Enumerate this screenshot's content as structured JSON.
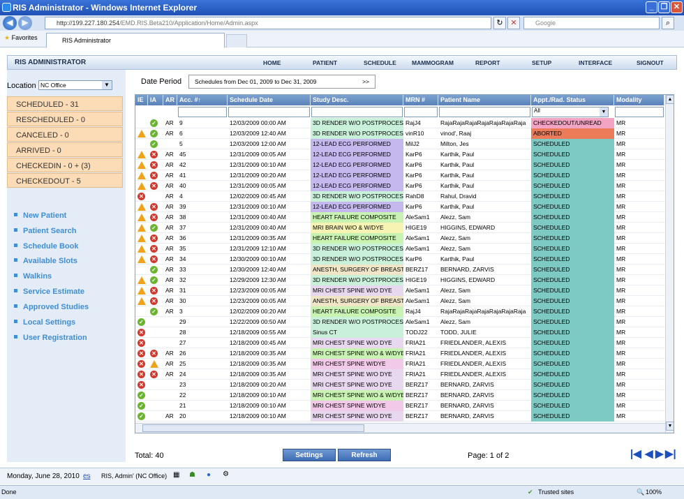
{
  "browser": {
    "title": "RIS Administrator - Windows Internet Explorer",
    "url_host": "http://199.227.180.254",
    "url_path": "/EMD.RIS.Beta210/Application/Home/Admin.aspx",
    "search_placeholder": "Google",
    "favorites_label": "Favorites",
    "tab_label": "RIS Administrator",
    "status_left": "Done",
    "status_zone": "Trusted sites",
    "zoom": "100%"
  },
  "app": {
    "title": "RIS ADMINISTRATOR",
    "menu": [
      "HOME",
      "PATIENT",
      "SCHEDULE",
      "MAMMOGRAM",
      "REPORT",
      "SETUP",
      "INTERFACE",
      "SIGNOUT"
    ]
  },
  "sidebar": {
    "location_label": "Location",
    "location_value": "NC Office",
    "statuses": [
      "SCHEDULED - 31",
      "RESCHEDULED - 0",
      "CANCELED - 0",
      "ARRIVED - 0",
      "CHECKEDIN - 0 + (3)",
      "CHECKEDOUT - 5"
    ],
    "links": [
      "New Patient",
      "Patient Search",
      "Schedule Book",
      "Available Slots",
      "Walkins",
      "Service Estimate",
      "Approved Studies",
      "Local Settings",
      "User Registration"
    ]
  },
  "filter": {
    "date_period_label": "Date Period",
    "date_period_value": "Schedules from Dec 01, 2009 to Dec 31, 2009",
    "arrow": ">>",
    "status_filter": "All"
  },
  "grid": {
    "columns": [
      "IE",
      "IA",
      "AR",
      "Acc. #↑",
      "Schedule Date",
      "Study Desc.",
      "MRN #",
      "Patient Name",
      "Appt./Rad. Status",
      "Modality"
    ],
    "rows": [
      {
        "ie": "",
        "ia": "ok",
        "ar": "AR",
        "acc": "9",
        "date": "12/03/2009 00:00 AM",
        "study": "3D RENDER W/O POSTPROCESS",
        "sc": "#c9f1da",
        "mrn": "RajJ4",
        "name": "RajaRajaRajaRajaRajaRajaRaja",
        "status": "CHECKEDOUT/UNREAD",
        "stc": "#f3a3c4",
        "mod": "MR"
      },
      {
        "ie": "w",
        "ia": "ok",
        "ar": "AR",
        "acc": "6",
        "date": "12/03/2009 12:40 AM",
        "study": "3D RENDER W/O POSTPROCESS",
        "sc": "#c9f1da",
        "mrn": "vinR10",
        "name": "vinod', Raaj",
        "status": "ABORTED",
        "stc": "#ec7b5a",
        "mod": "MR"
      },
      {
        "ie": "",
        "ia": "ok",
        "ar": "",
        "acc": "5",
        "date": "12/03/2009 12:00 AM",
        "study": "12-LEAD ECG PERFORMED",
        "sc": "#c4b8ee",
        "mrn": "MilJ2",
        "name": "Milton, Jes",
        "status": "SCHEDULED",
        "stc": "#7dcac5",
        "mod": "MR"
      },
      {
        "ie": "w",
        "ia": "x",
        "ar": "AR",
        "acc": "45",
        "date": "12/31/2009 00:05 AM",
        "study": "12-LEAD ECG PERFORMED",
        "sc": "#c4b8ee",
        "mrn": "KarP6",
        "name": "Karthik, Paul",
        "status": "SCHEDULED",
        "stc": "#7dcac5",
        "mod": "MR"
      },
      {
        "ie": "w",
        "ia": "x",
        "ar": "AR",
        "acc": "42",
        "date": "12/31/2009 00:10 AM",
        "study": "12-LEAD ECG PERFORMED",
        "sc": "#c4b8ee",
        "mrn": "KarP6",
        "name": "Karthik, Paul",
        "status": "SCHEDULED",
        "stc": "#7dcac5",
        "mod": "MR"
      },
      {
        "ie": "w",
        "ia": "x",
        "ar": "AR",
        "acc": "41",
        "date": "12/31/2009 00:20 AM",
        "study": "12-LEAD ECG PERFORMED",
        "sc": "#c4b8ee",
        "mrn": "KarP6",
        "name": "Karthik, Paul",
        "status": "SCHEDULED",
        "stc": "#7dcac5",
        "mod": "MR"
      },
      {
        "ie": "w",
        "ia": "x",
        "ar": "AR",
        "acc": "40",
        "date": "12/31/2009 00:05 AM",
        "study": "12-LEAD ECG PERFORMED",
        "sc": "#c4b8ee",
        "mrn": "KarP6",
        "name": "Karthik, Paul",
        "status": "SCHEDULED",
        "stc": "#7dcac5",
        "mod": "MR"
      },
      {
        "ie": "x",
        "ia": "",
        "ar": "AR",
        "acc": "4",
        "date": "12/02/2009 00:45 AM",
        "study": "3D RENDER W/O POSTPROCESS",
        "sc": "#c9f1da",
        "mrn": "RahD8",
        "name": "Rahul, Dravid",
        "status": "SCHEDULED",
        "stc": "#7dcac5",
        "mod": "MR"
      },
      {
        "ie": "w",
        "ia": "x",
        "ar": "AR",
        "acc": "39",
        "date": "12/31/2009 00:10 AM",
        "study": "12-LEAD ECG PERFORMED",
        "sc": "#c4b8ee",
        "mrn": "KarP6",
        "name": "Karthik, Paul",
        "status": "SCHEDULED",
        "stc": "#7dcac5",
        "mod": "MR"
      },
      {
        "ie": "w",
        "ia": "x",
        "ar": "AR",
        "acc": "38",
        "date": "12/31/2009 00:40 AM",
        "study": "HEART FAILURE COMPOSITE",
        "sc": "#c8f3b2",
        "mrn": "AleSam1",
        "name": "Alezz, Sam",
        "status": "SCHEDULED",
        "stc": "#7dcac5",
        "mod": "MR"
      },
      {
        "ie": "w",
        "ia": "ok",
        "ar": "AR",
        "acc": "37",
        "date": "12/31/2009 00:40 AM",
        "study": "MRI BRAIN W/O & W/DYE",
        "sc": "#f7f3b3",
        "mrn": "HIGE19",
        "name": "HIGGINS, EDWARD",
        "status": "SCHEDULED",
        "stc": "#7dcac5",
        "mod": "MR"
      },
      {
        "ie": "w",
        "ia": "x",
        "ar": "AR",
        "acc": "36",
        "date": "12/31/2009 00:35 AM",
        "study": "HEART FAILURE COMPOSITE",
        "sc": "#c8f3b2",
        "mrn": "AleSam1",
        "name": "Alezz, Sam",
        "status": "SCHEDULED",
        "stc": "#7dcac5",
        "mod": "MR"
      },
      {
        "ie": "w",
        "ia": "x",
        "ar": "AR",
        "acc": "35",
        "date": "12/31/2009 12:10 AM",
        "study": "3D RENDER W/O POSTPROCESS",
        "sc": "#c9f1da",
        "mrn": "AleSam1",
        "name": "Alezz, Sam",
        "status": "SCHEDULED",
        "stc": "#7dcac5",
        "mod": "MR"
      },
      {
        "ie": "w",
        "ia": "x",
        "ar": "AR",
        "acc": "34",
        "date": "12/30/2009 00:10 AM",
        "study": "3D RENDER W/O POSTPROCESS",
        "sc": "#c9f1da",
        "mrn": "KarP6",
        "name": "Karthik, Paul",
        "status": "SCHEDULED",
        "stc": "#7dcac5",
        "mod": "MR"
      },
      {
        "ie": "",
        "ia": "ok",
        "ar": "AR",
        "acc": "33",
        "date": "12/30/2009 12:40 AM",
        "study": "ANESTH, SURGERY OF BREAST",
        "sc": "#f1e5c8",
        "mrn": "BERZ17",
        "name": "BERNARD, ZARVIS",
        "status": "SCHEDULED",
        "stc": "#7dcac5",
        "mod": "MR"
      },
      {
        "ie": "w",
        "ia": "ok",
        "ar": "AR",
        "acc": "32",
        "date": "12/29/2009 12:30 AM",
        "study": "3D RENDER W/O POSTPROCESS",
        "sc": "#c9f1da",
        "mrn": "HIGE19",
        "name": "HIGGINS, EDWARD",
        "status": "SCHEDULED",
        "stc": "#7dcac5",
        "mod": "MR"
      },
      {
        "ie": "w",
        "ia": "x",
        "ar": "AR",
        "acc": "31",
        "date": "12/23/2009 00:05 AM",
        "study": "MRI CHEST SPINE W/O DYE",
        "sc": "#e8d8ef",
        "mrn": "AleSam1",
        "name": "Alezz, Sam",
        "status": "SCHEDULED",
        "stc": "#7dcac5",
        "mod": "MR"
      },
      {
        "ie": "w",
        "ia": "x",
        "ar": "AR",
        "acc": "30",
        "date": "12/23/2009 00:05 AM",
        "study": "ANESTH, SURGERY OF BREAST",
        "sc": "#f1e5c8",
        "mrn": "AleSam1",
        "name": "Alezz, Sam",
        "status": "SCHEDULED",
        "stc": "#7dcac5",
        "mod": "MR"
      },
      {
        "ie": "",
        "ia": "ok",
        "ar": "AR",
        "acc": "3",
        "date": "12/02/2009 00:20 AM",
        "study": "HEART FAILURE COMPOSITE",
        "sc": "#c8f3b2",
        "mrn": "RajJ4",
        "name": "RajaRajaRajaRajaRajaRajaRaja",
        "status": "SCHEDULED",
        "stc": "#7dcac5",
        "mod": "MR"
      },
      {
        "ie": "ok",
        "ia": "",
        "ar": "",
        "acc": "29",
        "date": "12/22/2009 00:50 AM",
        "study": "3D RENDER W/O POSTPROCESS",
        "sc": "#c9f1da",
        "mrn": "AleSam1",
        "name": "Alezz, Sam",
        "status": "SCHEDULED",
        "stc": "#7dcac5",
        "mod": "MR"
      },
      {
        "ie": "x",
        "ia": "",
        "ar": "",
        "acc": "28",
        "date": "12/18/2009 00:55 AM",
        "study": "Sinus CT",
        "sc": "#c9f1da",
        "mrn": "TODJ22",
        "name": "TODD, JULIE",
        "status": "SCHEDULED",
        "stc": "#7dcac5",
        "mod": "MR"
      },
      {
        "ie": "x",
        "ia": "",
        "ar": "",
        "acc": "27",
        "date": "12/18/2009 00:45 AM",
        "study": "MRI CHEST SPINE W/O DYE",
        "sc": "#e8d8ef",
        "mrn": "FRIA21",
        "name": "FRIEDLANDER, ALEXIS",
        "status": "SCHEDULED",
        "stc": "#7dcac5",
        "mod": "MR"
      },
      {
        "ie": "x",
        "ia": "x",
        "ar": "AR",
        "acc": "26",
        "date": "12/18/2009 00:35 AM",
        "study": "MRI CHEST SPINE W/O & W/DYE",
        "sc": "#c8f3b2",
        "mrn": "FRIA21",
        "name": "FRIEDLANDER, ALEXIS",
        "status": "SCHEDULED",
        "stc": "#7dcac5",
        "mod": "MR"
      },
      {
        "ie": "x",
        "ia": "w",
        "ar": "AR",
        "acc": "25",
        "date": "12/18/2009 00:35 AM",
        "study": "MRI CHEST SPINE W/DYE",
        "sc": "#f2c9e8",
        "mrn": "FRIA21",
        "name": "FRIEDLANDER, ALEXIS",
        "status": "SCHEDULED",
        "stc": "#7dcac5",
        "mod": "MR"
      },
      {
        "ie": "x",
        "ia": "x",
        "ar": "AR",
        "acc": "24",
        "date": "12/18/2009 00:35 AM",
        "study": "MRI CHEST SPINE W/O DYE",
        "sc": "#e8d8ef",
        "mrn": "FRIA21",
        "name": "FRIEDLANDER, ALEXIS",
        "status": "SCHEDULED",
        "stc": "#7dcac5",
        "mod": "MR"
      },
      {
        "ie": "x",
        "ia": "",
        "ar": "",
        "acc": "23",
        "date": "12/18/2009 00:20 AM",
        "study": "MRI CHEST SPINE W/O DYE",
        "sc": "#e8d8ef",
        "mrn": "BERZ17",
        "name": "BERNARD, ZARVIS",
        "status": "SCHEDULED",
        "stc": "#7dcac5",
        "mod": "MR"
      },
      {
        "ie": "ok",
        "ia": "",
        "ar": "",
        "acc": "22",
        "date": "12/18/2009 00:10 AM",
        "study": "MRI CHEST SPINE W/O & W/DYE",
        "sc": "#c8f3b2",
        "mrn": "BERZ17",
        "name": "BERNARD, ZARVIS",
        "status": "SCHEDULED",
        "stc": "#7dcac5",
        "mod": "MR"
      },
      {
        "ie": "ok",
        "ia": "",
        "ar": "",
        "acc": "21",
        "date": "12/18/2009 00:10 AM",
        "study": "MRI CHEST SPINE W/DYE",
        "sc": "#f2c9e8",
        "mrn": "BERZ17",
        "name": "BERNARD, ZARVIS",
        "status": "SCHEDULED",
        "stc": "#7dcac5",
        "mod": "MR"
      },
      {
        "ie": "ok",
        "ia": "",
        "ar": "AR",
        "acc": "20",
        "date": "12/18/2009 00:10 AM",
        "study": "MRI CHEST SPINE W/O DYE",
        "sc": "#e8d8ef",
        "mrn": "BERZ17",
        "name": "BERNARD, ZARVIS",
        "status": "SCHEDULED",
        "stc": "#7dcac5",
        "mod": "MR"
      }
    ]
  },
  "bottom": {
    "total": "Total: 40",
    "settings_label": "Settings",
    "refresh_label": "Refresh",
    "page": "Page: 1 of 2"
  },
  "footer": {
    "date": "Monday, June 28, 2010",
    "lang": "es",
    "user": "RIS, Admin' (NC Office)"
  }
}
